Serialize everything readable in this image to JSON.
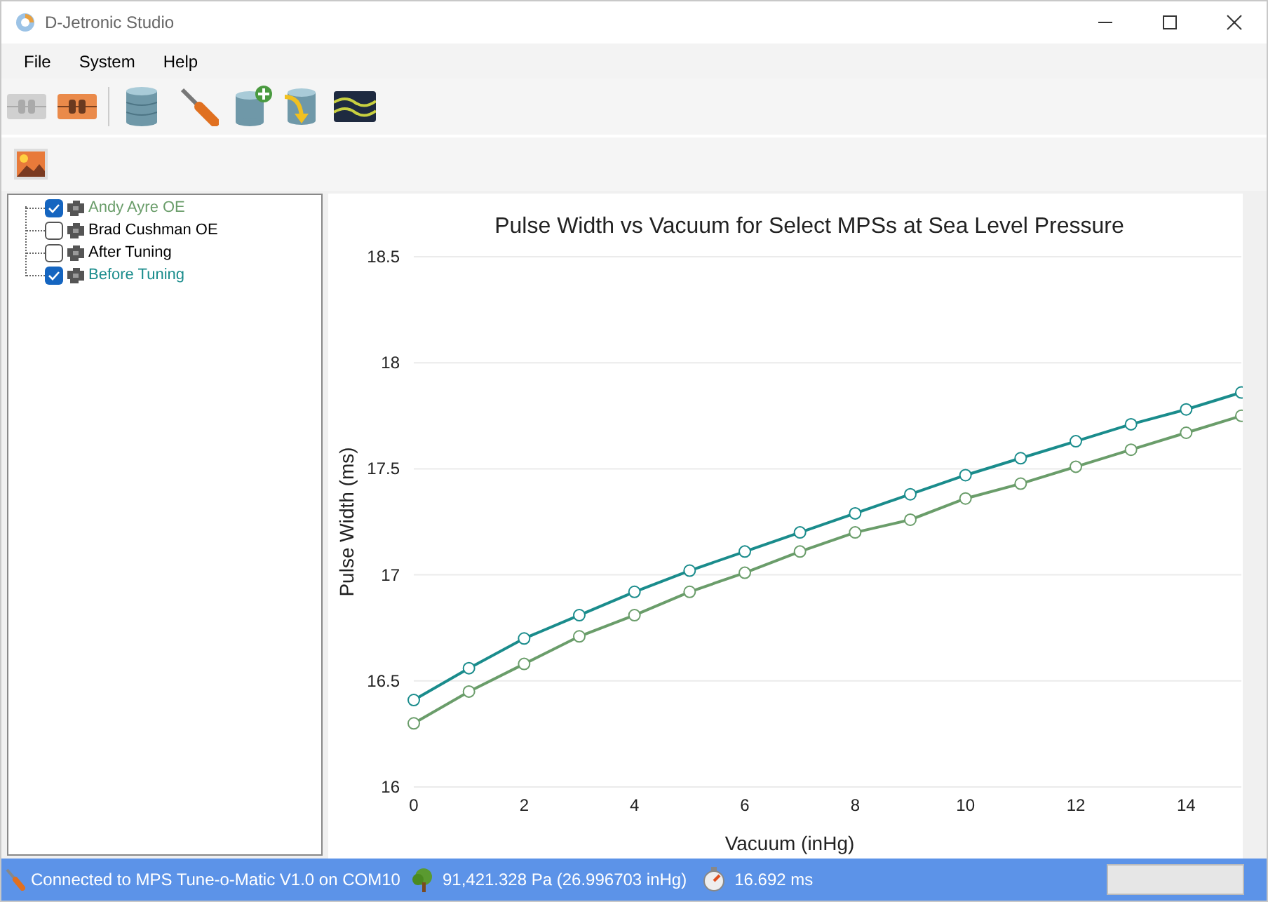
{
  "window": {
    "title": "D-Jetronic Studio"
  },
  "menu": [
    "File",
    "System",
    "Help"
  ],
  "tree": {
    "items": [
      {
        "label": "Andy Ayre OE",
        "checked": true,
        "color": "#6a9d6a"
      },
      {
        "label": "Brad Cushman OE",
        "checked": false,
        "color": "#000000"
      },
      {
        "label": "After Tuning",
        "checked": false,
        "color": "#000000"
      },
      {
        "label": "Before Tuning",
        "checked": true,
        "color": "#1a8c8c"
      }
    ]
  },
  "chart": {
    "chart_data": {
      "type": "line",
      "title": "Pulse Width vs Vacuum for Select MPSs at Sea Level Pressure",
      "xlabel": "Vacuum (inHg)",
      "ylabel": "Pulse Width (ms)",
      "x": [
        0,
        1,
        2,
        3,
        4,
        5,
        6,
        7,
        8,
        9,
        10,
        11,
        12,
        13,
        14,
        15
      ],
      "series": [
        {
          "color": "#1a8c8c",
          "marker": "circle",
          "values": [
            16.41,
            16.56,
            16.7,
            16.81,
            16.92,
            17.02,
            17.11,
            17.2,
            17.29,
            17.38,
            17.47,
            17.55,
            17.63,
            17.71,
            17.78,
            17.86
          ]
        },
        {
          "color": "#6a9d6a",
          "marker": "circle",
          "values": [
            16.3,
            16.45,
            16.58,
            16.71,
            16.81,
            16.92,
            17.01,
            17.11,
            17.2,
            17.26,
            17.36,
            17.43,
            17.51,
            17.59,
            17.67,
            17.75
          ]
        }
      ],
      "grid": true,
      "xlim": [
        0,
        15
      ],
      "ylim": [
        16,
        18.5
      ],
      "xticks": [
        0,
        2,
        4,
        6,
        8,
        10,
        12,
        14
      ],
      "yticks": [
        16,
        16.5,
        17,
        17.5,
        18,
        18.5
      ]
    }
  },
  "status_bar": {
    "connection": "Connected to MPS Tune-o-Matic V1.0 on COM10",
    "pressure": "91,421.328 Pa (26.996703 inHg)",
    "pulse": "16.692 ms",
    "progress": {
      "level": 0
    }
  }
}
